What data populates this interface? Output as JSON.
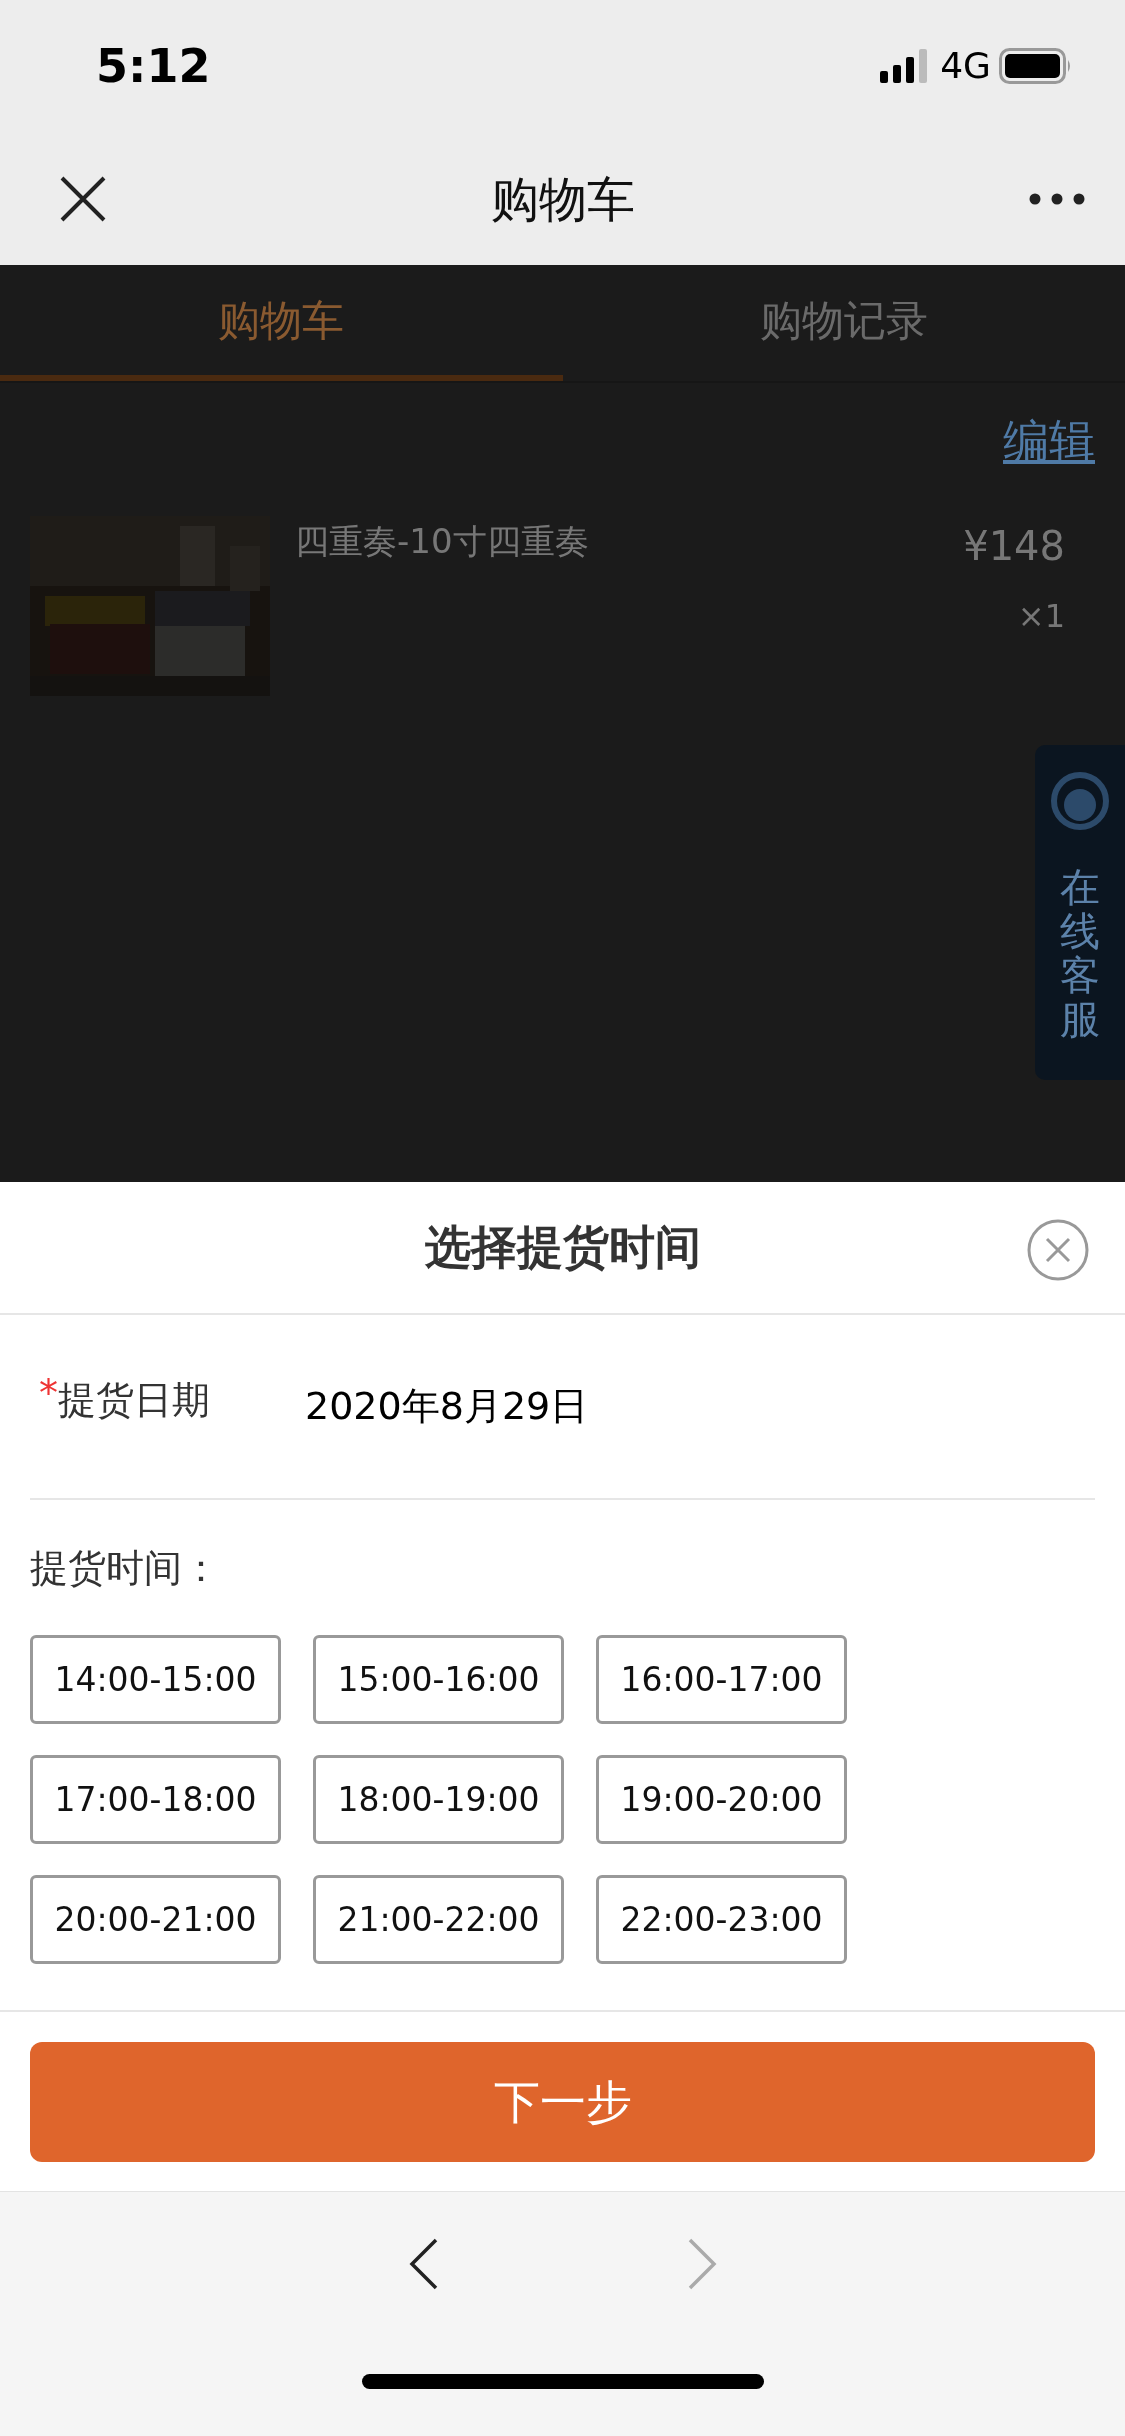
{
  "status_bar": {
    "time": "5:12",
    "network": "4G"
  },
  "nav_bar": {
    "title": "购物车"
  },
  "tabs": [
    {
      "label": "购物车",
      "selected": true
    },
    {
      "label": "购物记录",
      "selected": false
    }
  ],
  "edit_link": "编辑",
  "cart_items": [
    {
      "name": "四重奏-10寸四重奏",
      "price": "¥148",
      "quantity": "×1"
    }
  ],
  "service_tab": {
    "label": "在线客服"
  },
  "dialog": {
    "title": "选择提货时间",
    "date_field": {
      "required_mark": "*",
      "label": "提货日期",
      "value": "2020年8月29日"
    },
    "time_label": "提货时间：",
    "time_slots": [
      {
        "label": "14:00-15:00",
        "selected": false
      },
      {
        "label": "15:00-16:00",
        "selected": false
      },
      {
        "label": "16:00-17:00",
        "selected": false
      },
      {
        "label": "17:00-18:00",
        "selected": false
      },
      {
        "label": "18:00-19:00",
        "selected": false
      },
      {
        "label": "19:00-20:00",
        "selected": false
      },
      {
        "label": "20:00-21:00",
        "selected": false
      },
      {
        "label": "21:00-22:00",
        "selected": false
      },
      {
        "label": "22:00-23:00",
        "selected": false
      }
    ],
    "next_button": "下一步"
  },
  "browser_toolbar": {
    "back": {
      "disabled": false
    },
    "forward": {
      "disabled": true
    }
  }
}
